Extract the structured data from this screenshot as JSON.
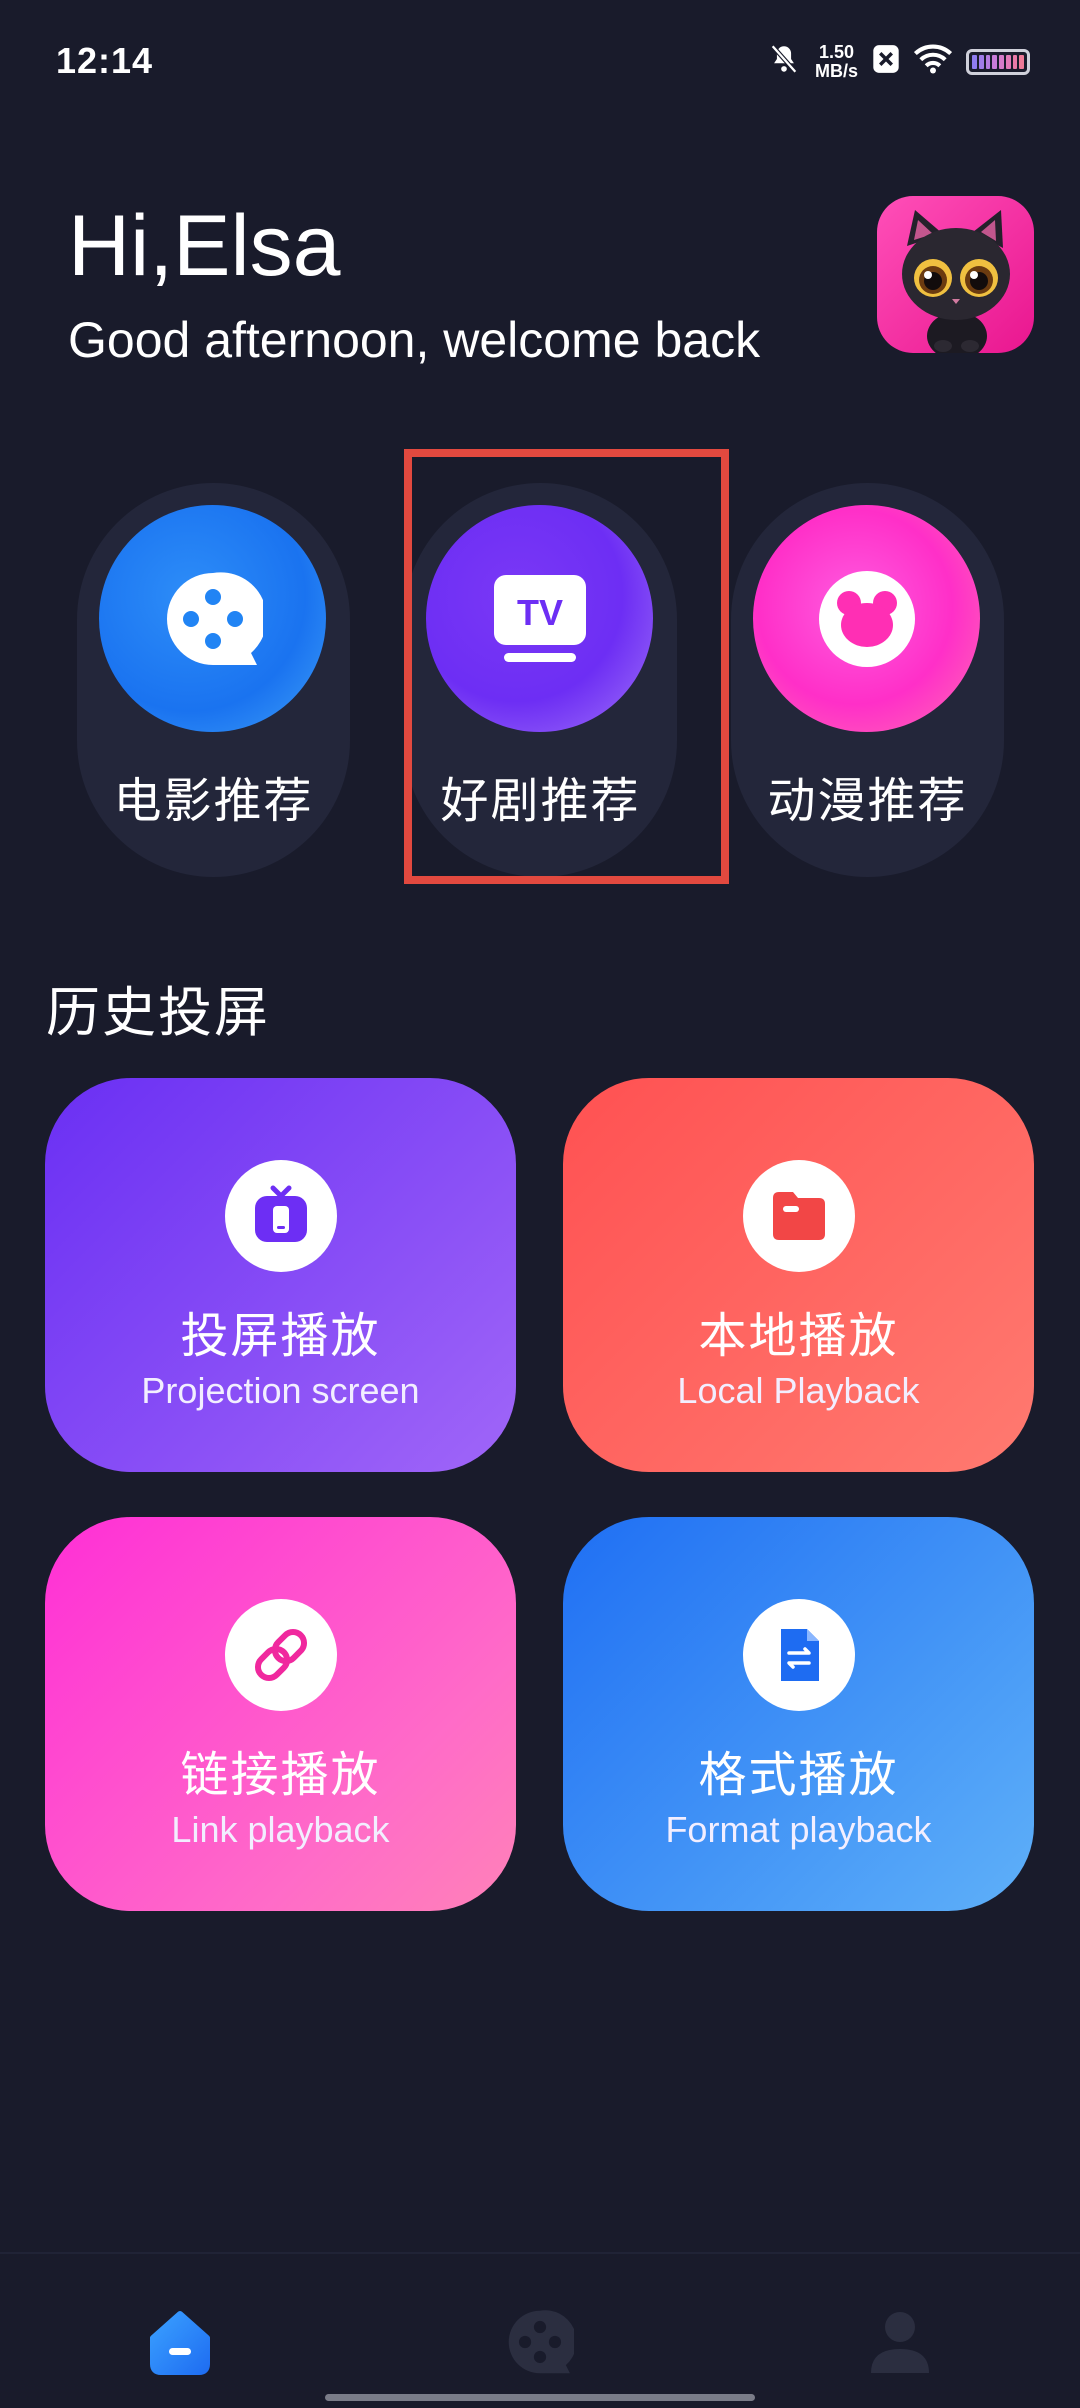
{
  "status_bar": {
    "time": "12:14",
    "net_speed_value": "1.50",
    "net_speed_unit": "MB/s"
  },
  "header": {
    "greeting": "Hi,Elsa",
    "subtitle": "Good afternoon, welcome back"
  },
  "categories": [
    {
      "label": "电影推荐",
      "icon": "film-reel-icon"
    },
    {
      "label": "好剧推荐",
      "icon": "tv-icon"
    },
    {
      "label": "动漫推荐",
      "icon": "bear-icon"
    }
  ],
  "section": {
    "title": "历史投屏"
  },
  "cards": [
    {
      "title": "投屏播放",
      "subtitle": "Projection screen",
      "icon": "cast-tv-icon"
    },
    {
      "title": "本地播放",
      "subtitle": "Local Playback",
      "icon": "folder-icon"
    },
    {
      "title": "链接播放",
      "subtitle": "Link playback",
      "icon": "link-icon"
    },
    {
      "title": "格式播放",
      "subtitle": "Format playback",
      "icon": "file-convert-icon"
    }
  ],
  "nav": [
    {
      "icon": "home-icon",
      "active": true
    },
    {
      "icon": "film-reel-icon",
      "active": false
    },
    {
      "icon": "profile-icon",
      "active": false
    }
  ],
  "colors": {
    "background": "#191b2b",
    "highlight": "#e2493f",
    "purple": "#7b3ef7",
    "coral": "#ff5b57",
    "pink": "#ff37cf",
    "blue": "#2d7cf6"
  }
}
